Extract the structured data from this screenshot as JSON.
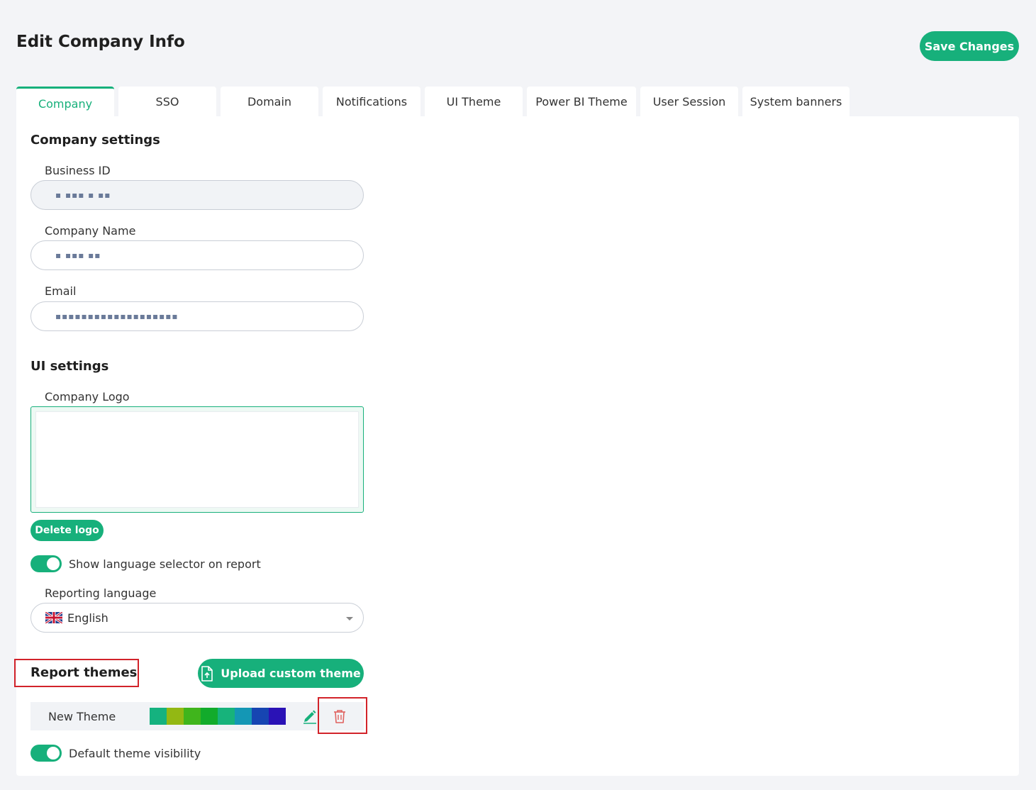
{
  "page": {
    "title": "Edit Company Info",
    "save_label": "Save Changes"
  },
  "tabs": [
    {
      "label": "Company",
      "active": true
    },
    {
      "label": "SSO"
    },
    {
      "label": "Domain"
    },
    {
      "label": "Notifications"
    },
    {
      "label": "UI Theme"
    },
    {
      "label": "Power BI Theme"
    },
    {
      "label": "User Session"
    },
    {
      "label": "System banners"
    }
  ],
  "company_settings": {
    "title": "Company settings",
    "business_id_label": "Business ID",
    "business_id_value": "▪ ▪▪▪ ▪ ▪▪",
    "company_name_label": "Company Name",
    "company_name_value": "▪  ▪▪▪ ▪▪",
    "email_label": "Email",
    "email_value": "▪▪▪▪▪▪▪▪▪▪▪▪▪▪▪▪▪▪▪"
  },
  "ui_settings": {
    "title": "UI settings",
    "logo_label": "Company Logo",
    "delete_logo_label": "Delete logo",
    "language_selector_label": "Show language selector on report",
    "language_selector_on": true,
    "reporting_language_label": "Reporting language",
    "reporting_language_value": "English"
  },
  "report_themes": {
    "title": "Report themes",
    "upload_label": "Upload custom theme",
    "themes": [
      {
        "name": "New Theme",
        "colors": [
          "#15b27f",
          "#93b813",
          "#40b51c",
          "#12ab2b",
          "#17b37b",
          "#1497b5",
          "#1645b2",
          "#2a12b6"
        ]
      }
    ],
    "default_visibility_label": "Default theme visibility",
    "default_visibility_on": true
  },
  "colors": {
    "accent": "#17b07b",
    "highlight": "#d2232a",
    "delete_icon": "#e0625f"
  }
}
